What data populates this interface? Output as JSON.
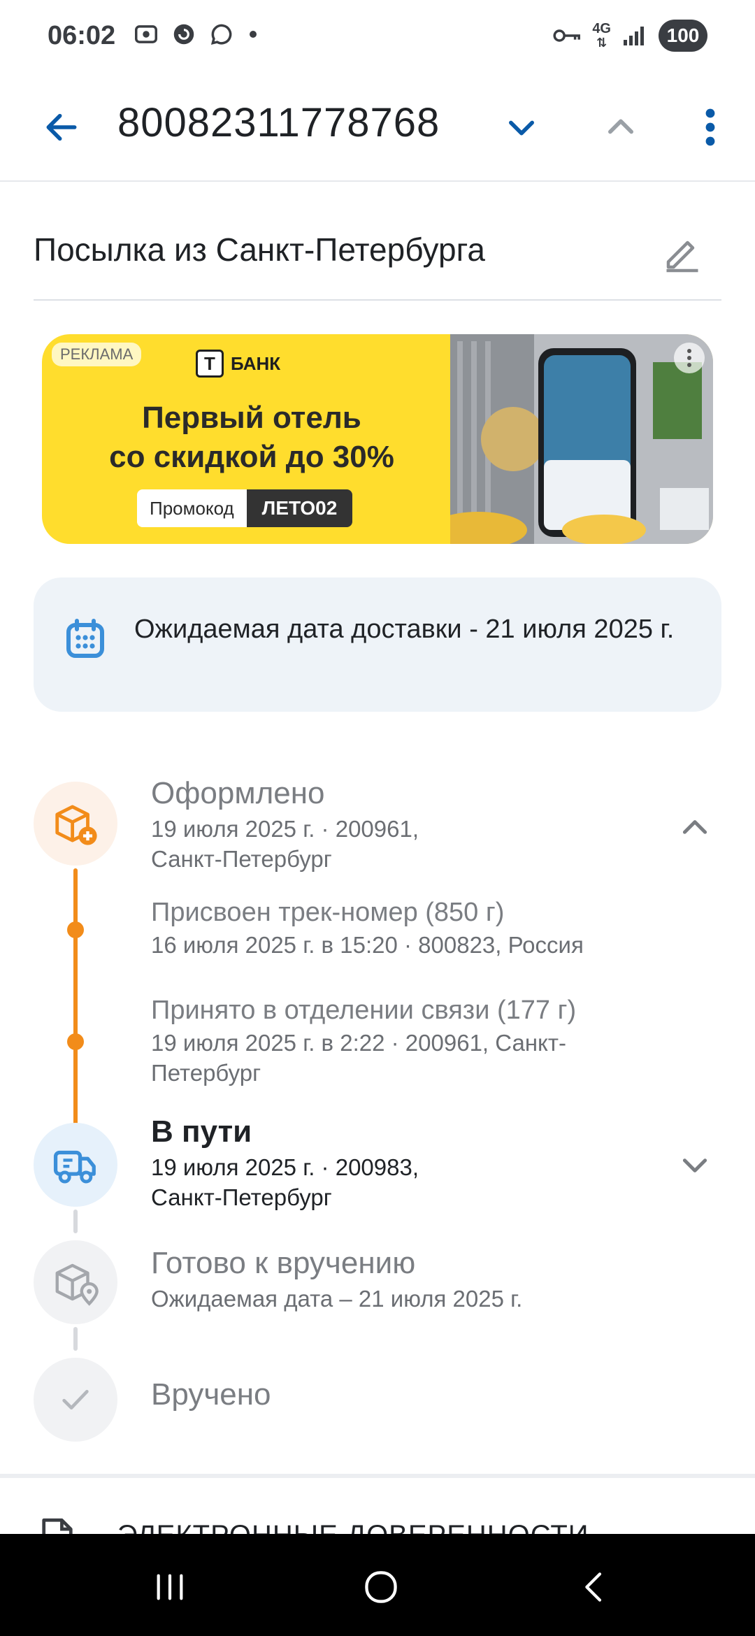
{
  "status_bar": {
    "time": "06:02",
    "network": "4G",
    "battery": "100"
  },
  "app_bar": {
    "track_number": "80082311778768"
  },
  "parcel": {
    "title": "Посылка из Санкт-Петербурга"
  },
  "ad": {
    "label": "РЕКЛАМА",
    "brand_letter": "Т",
    "brand_name": "БАНК",
    "headline_line1": "Первый отель",
    "headline_line2": "со скидкой до 30%",
    "promo_label": "Промокод",
    "promo_code": "ЛЕТО02"
  },
  "delivery": {
    "text": "Ожидаемая дата доставки - 21 июля 2025 г."
  },
  "timeline": {
    "stage1": {
      "title": "Оформлено",
      "sub": "19 июля 2025 г. · 200961, Санкт-Петербург"
    },
    "step1": {
      "title": "Присвоен трек-номер (850 г)",
      "sub": "16 июля 2025 г. в 15:20 · 800823, Россия"
    },
    "step2": {
      "title": "Принято в отделении связи (177 г)",
      "sub": "19 июля 2025 г. в 2:22 · 200961, Санкт-Петербург"
    },
    "stage2": {
      "title": "В пути",
      "sub": "19 июля 2025 г. · 200983, Санкт-Петербург"
    },
    "stage3": {
      "title": "Готово к вручению",
      "sub": "Ожидаемая дата – 21 июля 2025 г."
    },
    "stage4": {
      "title": "Вручено"
    }
  },
  "power_of_attorney": {
    "label": "ЭЛЕКТРОННЫЕ ДОВЕРЕННОСТИ"
  },
  "colors": {
    "accent_blue": "#0a5aa8",
    "timeline_orange": "#f28c1a",
    "ad_yellow": "#ffdd2d"
  },
  "icons": {
    "back": "arrow-left-icon",
    "next": "chevron-down-icon",
    "prev": "chevron-up-icon",
    "more": "more-vertical-icon",
    "edit": "pencil-icon",
    "calendar": "calendar-icon",
    "created": "box-plus-icon",
    "transit": "truck-icon",
    "ready": "box-location-icon",
    "delivered": "check-icon",
    "document": "document-icon"
  }
}
